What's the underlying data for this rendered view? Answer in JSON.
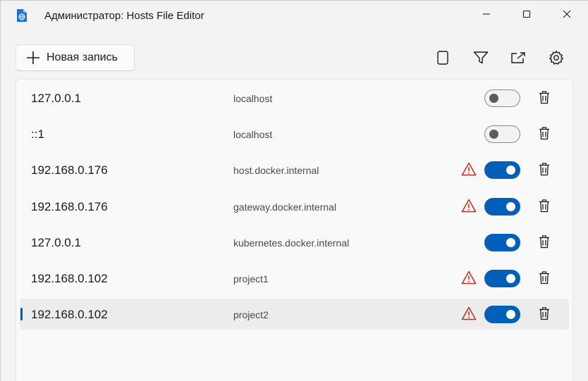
{
  "window": {
    "title": "Администратор: Hosts File Editor",
    "app_icon": "hosts-file-icon",
    "controls": [
      "minimize-icon",
      "maximize-icon",
      "close-icon"
    ]
  },
  "toolbar": {
    "new_entry_label": "Новая запись",
    "new_entry_icon": "plus-icon",
    "tools": [
      "document-icon",
      "filter-icon",
      "open-external-icon",
      "settings-gear-icon"
    ]
  },
  "colors": {
    "accent": "#005fb8",
    "warning": "#c42b1c"
  },
  "entries": [
    {
      "ip": "127.0.0.1",
      "host": "localhost",
      "enabled": false,
      "warning": false,
      "selected": false
    },
    {
      "ip": "::1",
      "host": "localhost",
      "enabled": false,
      "warning": false,
      "selected": false
    },
    {
      "ip": "192.168.0.176",
      "host": "host.docker.internal",
      "enabled": true,
      "warning": true,
      "selected": false
    },
    {
      "ip": "192.168.0.176",
      "host": "gateway.docker.internal",
      "enabled": true,
      "warning": true,
      "selected": false
    },
    {
      "ip": "127.0.0.1",
      "host": "kubernetes.docker.internal",
      "enabled": true,
      "warning": false,
      "selected": false
    },
    {
      "ip": "192.168.0.102",
      "host": "project1",
      "enabled": true,
      "warning": true,
      "selected": false
    },
    {
      "ip": "192.168.0.102",
      "host": "project2",
      "enabled": true,
      "warning": true,
      "selected": true
    }
  ]
}
